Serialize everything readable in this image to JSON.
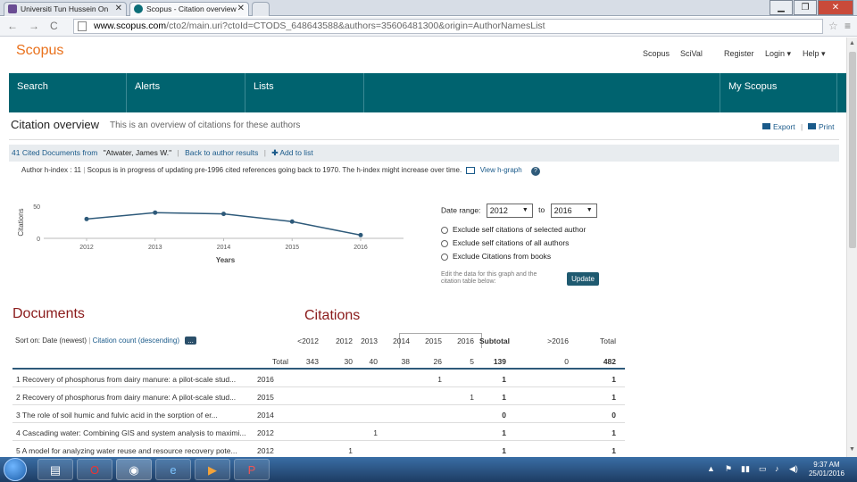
{
  "browser": {
    "tabs": [
      {
        "label": "Universiti Tun Hussein On"
      },
      {
        "label": "Scopus - Citation overview"
      }
    ],
    "url_host": "www.scopus.com",
    "url_rest": "/cto2/main.uri?ctoId=CTODS_648643588&authors=35606481300&origin=AuthorNamesList"
  },
  "header": {
    "logo": "Scopus",
    "links": [
      "Scopus",
      "SciVal",
      "Register",
      "Login",
      "Help"
    ]
  },
  "nav": [
    "Search",
    "Alerts",
    "Lists",
    "",
    "My Scopus"
  ],
  "page": {
    "title": "Citation overview",
    "subtitle": "This is an overview of citations for these authors",
    "export": "Export",
    "print": "Print",
    "cited_prefix": "41 Cited Documents from",
    "cited_author": "\"Atwater, James W.\"",
    "back_link": "Back to author results",
    "add_list": "Add to list",
    "author_h_index": "Author h-index : 11",
    "progress_note": "Scopus is in progress of updating pre-1996 cited references going back to 1970. The h-index might increase over time.",
    "view_graph": "View h-graph"
  },
  "chart_data": {
    "type": "line",
    "x": [
      "2012",
      "2013",
      "2014",
      "2015",
      "2016"
    ],
    "values": [
      30,
      40,
      38,
      26,
      5
    ],
    "xlabel": "Years",
    "ylabel": "Citations",
    "yticks": [
      "0",
      "50"
    ],
    "ylim": [
      0,
      50
    ],
    "color": "#2e5a7a"
  },
  "options": {
    "date_range_label": "Date range:",
    "from": "2012",
    "to_label": "to",
    "to": "2016",
    "exclude": [
      "Exclude self citations of selected author",
      "Exclude self citations of all authors",
      "Exclude Citations from books"
    ],
    "note": "Edit the data for this graph and the citation table below:",
    "update": "Update"
  },
  "documents": {
    "heading": "Documents",
    "citations_heading": "Citations",
    "sort_label": "Sort on:",
    "sort_date": "Date (newest)",
    "sort_count": "Citation count (descending)",
    "more": "...",
    "columns": [
      "<2012",
      "2012",
      "2013",
      "2014",
      "2015",
      "2016",
      "Subtotal",
      ">2016",
      "Total"
    ],
    "total_label": "Total",
    "totals": [
      "343",
      "30",
      "40",
      "38",
      "26",
      "5",
      "139",
      "0",
      "482"
    ],
    "rows": [
      {
        "title": "1  Recovery of phosphorus from dairy manure: a pilot-scale stud...",
        "year": "2016",
        "cells": [
          "",
          "",
          "",
          "",
          "1",
          "",
          "1",
          "",
          "1"
        ]
      },
      {
        "title": "2  Recovery of phosphorus from dairy manure: A pilot-scale stud...",
        "year": "2015",
        "cells": [
          "",
          "",
          "",
          "",
          "",
          "1",
          "1",
          "",
          "1"
        ]
      },
      {
        "title": "3  The role of soil humic and fulvic acid in the sorption of er...",
        "year": "2014",
        "cells": [
          "",
          "",
          "",
          "",
          "",
          "",
          "0",
          "",
          "0"
        ]
      },
      {
        "title": "4  Cascading water: Combining GIS and system analysis to maximi...",
        "year": "2012",
        "cells": [
          "",
          "",
          "1",
          "",
          "",
          "",
          "1",
          "",
          "1"
        ]
      },
      {
        "title": "5  A model for analyzing water reuse and resource recovery pote...",
        "year": "2012",
        "cells": [
          "",
          "1",
          "",
          "",
          "",
          "",
          "1",
          "",
          "1"
        ]
      }
    ]
  },
  "taskbar": {
    "time": "9:37 AM",
    "date": "25/01/2016"
  }
}
